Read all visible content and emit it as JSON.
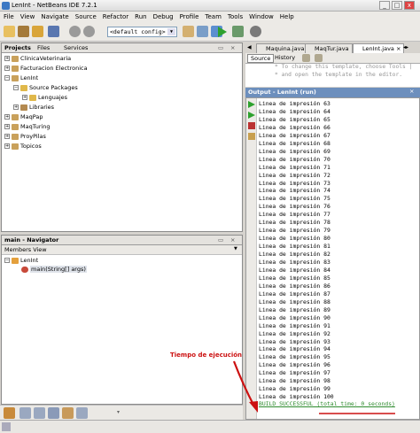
{
  "window": {
    "title": "LenInt - NetBeans IDE 7.2.1"
  },
  "menu": [
    "File",
    "View",
    "Navigate",
    "Source",
    "Refactor",
    "Run",
    "Debug",
    "Profile",
    "Team",
    "Tools",
    "Window",
    "Help"
  ],
  "toolbar": {
    "config": "<default config>"
  },
  "projects_panel": {
    "tabs": [
      "Projects",
      "Files",
      "Services"
    ],
    "tree": [
      {
        "label": "ClinicaVeterinaria"
      },
      {
        "label": "Facturacion Electronica"
      },
      {
        "label": "LenInt"
      },
      {
        "label": "Source Packages"
      },
      {
        "label": "Lenguajes"
      },
      {
        "label": "Libraries"
      },
      {
        "label": "MaqPap"
      },
      {
        "label": "MaqTuring"
      },
      {
        "label": "ProyPilas"
      },
      {
        "label": "Topicos"
      }
    ]
  },
  "navigator": {
    "title": "main - Navigator",
    "members_view": "Members View",
    "class_name": "LenInt",
    "method": "main(String[] args)"
  },
  "editor": {
    "tabs": [
      "Maquina.java",
      "MaqTur.java",
      "LenInt.java"
    ],
    "sub_tabs": [
      "Source",
      "History"
    ],
    "code_lines": [
      "* To change this template, choose Tools |",
      "* and open the template in the editor."
    ]
  },
  "output": {
    "title": "Output - LenInt (run)",
    "lines": [
      "Linea de impresión 63",
      "Linea de impresión 64",
      "Linea de impresión 65",
      "Linea de impresión 66",
      "Linea de impresión 67",
      "Linea de impresión 68",
      "Linea de impresión 69",
      "Linea de impresión 70",
      "Linea de impresión 71",
      "Linea de impresión 72",
      "Linea de impresión 73",
      "Linea de impresión 74",
      "Linea de impresión 75",
      "Linea de impresión 76",
      "Linea de impresión 77",
      "Linea de impresión 78",
      "Linea de impresión 79",
      "Linea de impresión 80",
      "Linea de impresión 81",
      "Linea de impresión 82",
      "Linea de impresión 83",
      "Linea de impresión 84",
      "Linea de impresión 85",
      "Linea de impresión 86",
      "Linea de impresión 87",
      "Linea de impresión 88",
      "Linea de impresión 89",
      "Linea de impresión 90",
      "Linea de impresión 91",
      "Linea de impresión 92",
      "Linea de impresión 93",
      "Linea de impresión 94",
      "Linea de impresión 95",
      "Linea de impresión 96",
      "Linea de impresión 97",
      "Linea de impresión 98",
      "Linea de impresión 99",
      "Linea de impresión 100"
    ],
    "build_line": "BUILD SUCCESSFUL (total time: 0 seconds)"
  },
  "annotation": {
    "text": "Tiempo de ejecución",
    "color": "#cc1111"
  },
  "colors": {
    "output_header": "#6d8fbd",
    "build_green": "#2e8b2e"
  }
}
